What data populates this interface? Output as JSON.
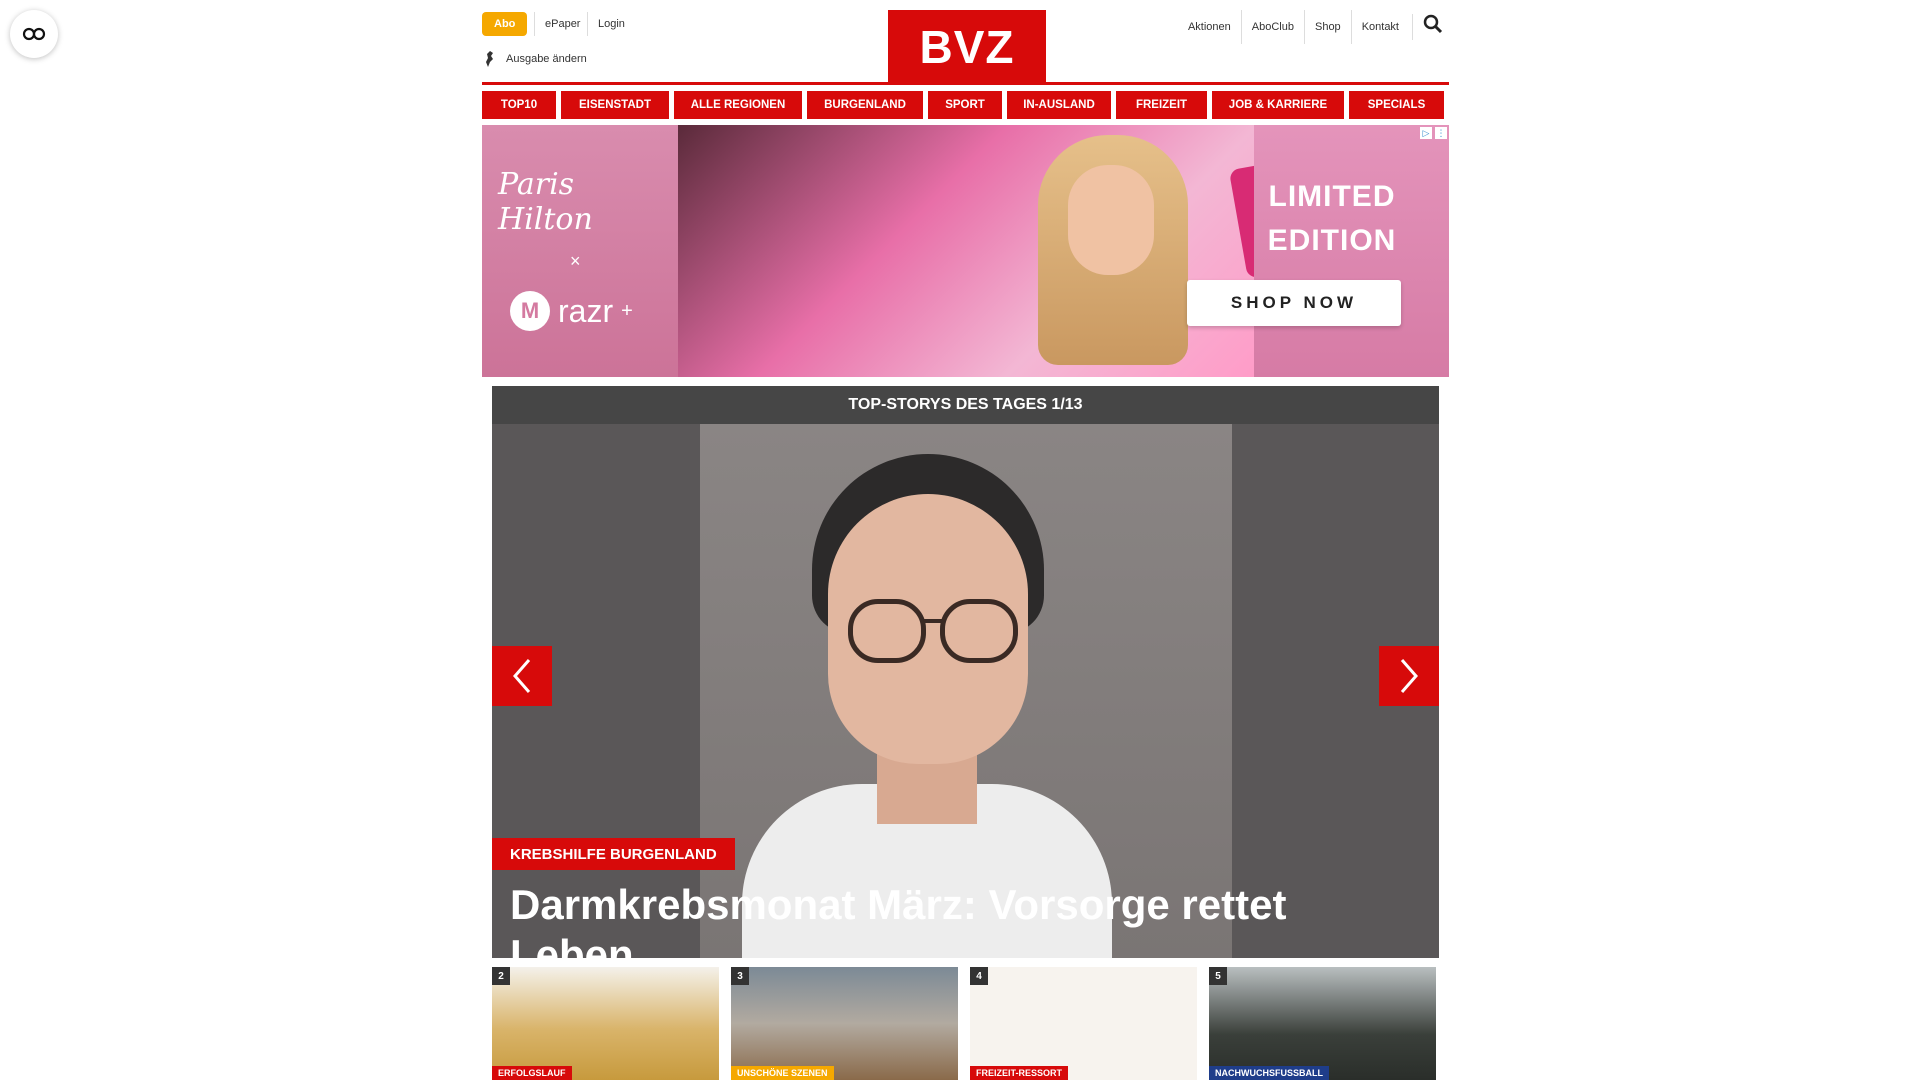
{
  "header": {
    "abo": "Abo",
    "epaper": "ePaper",
    "login": "Login",
    "ausgabe": "Ausgabe ändern",
    "logo": "BVZ",
    "links": [
      "Aktionen",
      "AboClub",
      "Shop",
      "Kontakt"
    ]
  },
  "nav": [
    "TOP10",
    "EISENSTADT",
    "ALLE REGIONEN",
    "BURGENLAND",
    "SPORT",
    "IN-AUSLAND",
    "FREIZEIT",
    "JOB & KARRIERE",
    "SPECIALS"
  ],
  "ad": {
    "signature": "Paris Hilton",
    "x": "×",
    "brand": "razr",
    "brand_sup": "+",
    "headline_1": "LIMITED",
    "headline_2": "EDITION",
    "cta": "SHOP NOW"
  },
  "carousel": {
    "title": "TOP-STORYS DES TAGES 1/13",
    "tag": "KREBSHILFE BURGENLAND",
    "headline": "Darmkrebsmonat März: Vorsorge rettet Leben"
  },
  "thumbs": [
    {
      "num": "2",
      "label": "ERFOLGSLAUF",
      "label_color": "#d70a0a"
    },
    {
      "num": "3",
      "label": "UNSCHÖNE SZENEN",
      "label_color": "#f5a800"
    },
    {
      "num": "4",
      "label": "FREIZEIT-RESSORT",
      "label_color": "#d70a0a"
    },
    {
      "num": "5",
      "label": "NACHWUCHSFUSSBALL",
      "label_color": "#1f3d8a"
    }
  ],
  "colors": {
    "brand_red": "#d70a0a",
    "abo_orange": "#f5a800"
  }
}
